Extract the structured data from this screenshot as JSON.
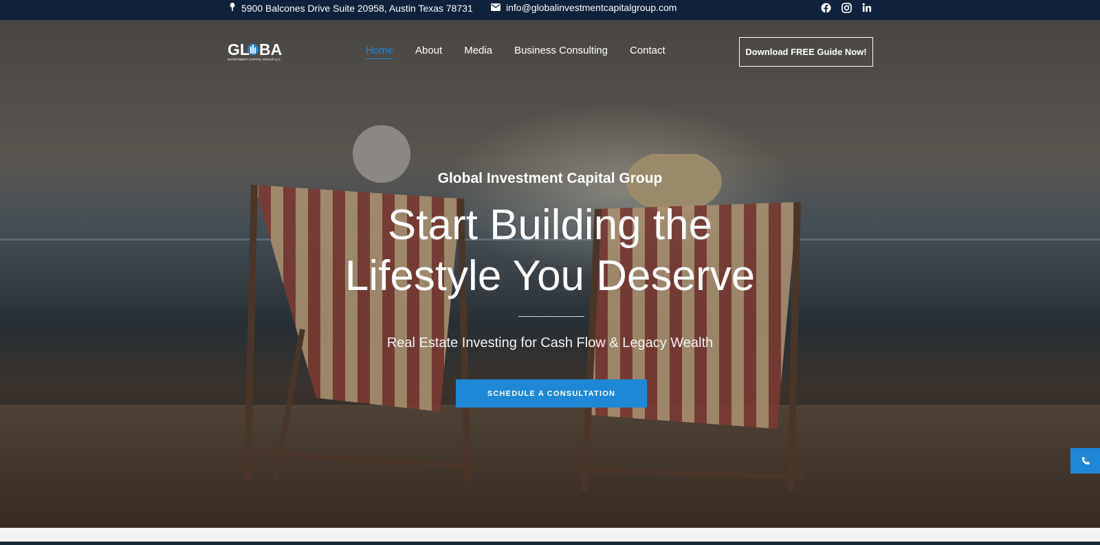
{
  "topbar": {
    "address": "5900 Balcones Drive Suite 20958, Austin Texas 78731",
    "email": "info@globalinvestmentcapitalgroup.com",
    "address_icon": "map-pin-icon",
    "email_icon": "envelope-icon",
    "socials": [
      "facebook-icon",
      "instagram-icon",
      "linkedin-icon"
    ]
  },
  "logo": {
    "text_main": "GL BAL",
    "text_sub": "INVESTMENT CAPITAL GROUP LLC"
  },
  "nav": {
    "items": [
      {
        "label": "Home",
        "active": true
      },
      {
        "label": "About"
      },
      {
        "label": "Media"
      },
      {
        "label": "Business Consulting"
      },
      {
        "label": "Contact"
      }
    ],
    "cta_label": "Download FREE Guide Now!"
  },
  "hero": {
    "subtitle": "Global Investment Capital Group",
    "title_line1": "Start Building the",
    "title_line2": "Lifestyle You Deserve",
    "tagline": "Real Estate Investing for Cash Flow & Legacy Wealth",
    "button_label": "SCHEDULE A CONSULTATION"
  },
  "colors": {
    "topbar_bg": "#0f213b",
    "accent": "#1e88d6"
  },
  "floating": {
    "phone_icon": "phone-icon"
  }
}
